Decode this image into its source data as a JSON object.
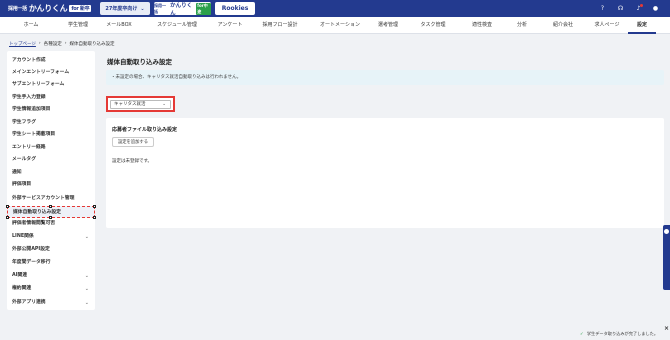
{
  "header": {
    "logo_small": "採用一括",
    "logo_main": "かんりくん",
    "logo_tag": "for 新卒",
    "year_selector": "27年度卒向け",
    "product_a_small": "採用一括",
    "product_a_main": "かんりくん",
    "product_a_tag": "for中途",
    "product_b": "Rookies"
  },
  "nav": {
    "items": [
      {
        "label": "ホーム"
      },
      {
        "label": "学生管理"
      },
      {
        "label": "メールBOX"
      },
      {
        "label": "スケジュール管理"
      },
      {
        "label": "アンケート"
      },
      {
        "label": "採用フロー設計"
      },
      {
        "label": "オートメーション"
      },
      {
        "label": "選考管理"
      },
      {
        "label": "タスク管理"
      },
      {
        "label": "適性検査"
      },
      {
        "label": "分析"
      },
      {
        "label": "紹介会社"
      },
      {
        "label": "求人ページ"
      },
      {
        "label": "設定"
      }
    ]
  },
  "breadcrumb": {
    "home": "トップページ",
    "settings": "各種設定",
    "current": "媒体自動取り込み設定"
  },
  "sidebar": {
    "items": [
      {
        "label": "アカウント作成"
      },
      {
        "label": "メインエントリーフォーム"
      },
      {
        "label": "サブエントリーフォーム"
      },
      {
        "label": "学生手入力登録"
      },
      {
        "label": "学生情報追加項目"
      },
      {
        "label": "学生フラグ"
      },
      {
        "label": "学生シート掲載項目"
      },
      {
        "label": "エントリー経路"
      },
      {
        "label": "メールタグ"
      },
      {
        "label": "通知"
      },
      {
        "label": "評価項目"
      },
      {
        "label": "外部サービスアカウント管理"
      },
      {
        "label": "媒体自動取り込み設定"
      },
      {
        "label": "評価者情報閲覧可否"
      },
      {
        "label": "LINE関係"
      },
      {
        "label": "外部公開API設定"
      },
      {
        "label": "年度間データ移行"
      },
      {
        "label": "AI関連"
      },
      {
        "label": "権約関連"
      },
      {
        "label": "外部アプリ連携"
      }
    ]
  },
  "main": {
    "title": "媒体自動取り込み設定",
    "notice": "・未設定の場合、キャリタス就活自動取り込みは行われません。",
    "media_select": "キャリタス就活",
    "card_title": "応募者ファイル取り込み設定",
    "add_button": "設定を追加する",
    "empty_text": "設定は未登録です。"
  },
  "toast": {
    "message": "学生データ取り込みが完了しました。"
  },
  "colors": {
    "brand": "#233a8f",
    "highlight": "#e53935",
    "notice_bg": "#e7f3f8"
  }
}
